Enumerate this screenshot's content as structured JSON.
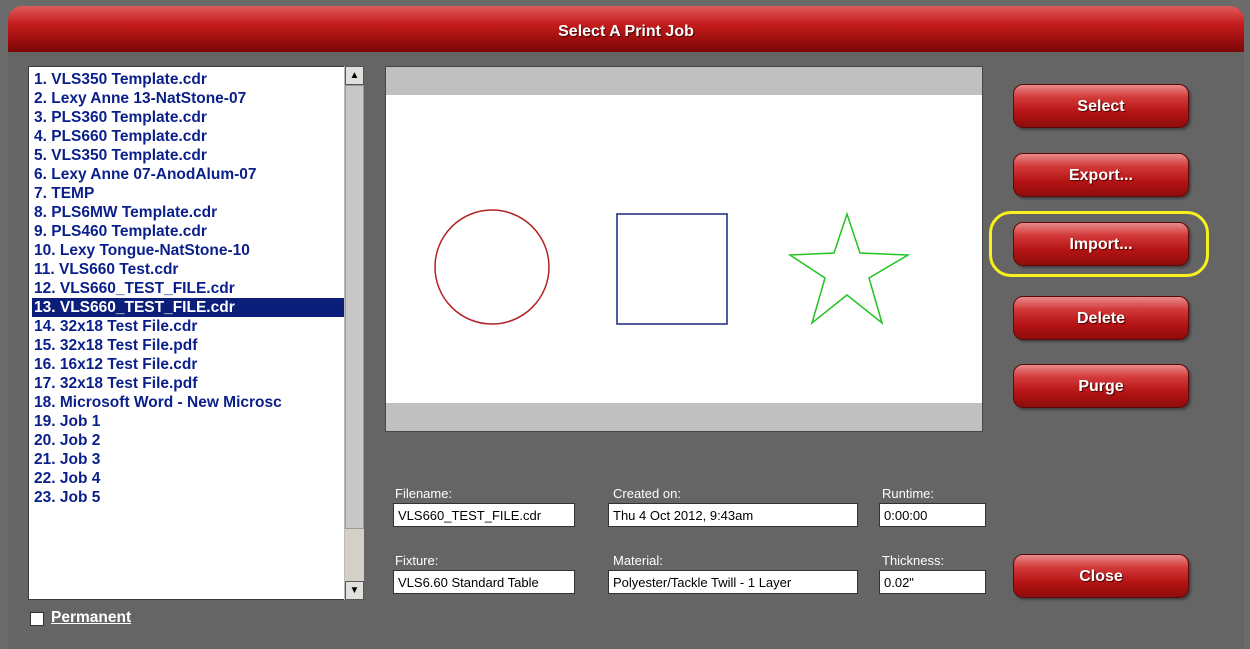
{
  "window": {
    "title": "Select A Print Job"
  },
  "job_list": {
    "items": [
      "1. VLS350 Template.cdr",
      "2. Lexy Anne 13-NatStone-07",
      "3. PLS360 Template.cdr",
      "4. PLS660 Template.cdr",
      "5. VLS350 Template.cdr",
      "6. Lexy Anne 07-AnodAlum-07",
      "7. TEMP",
      "8. PLS6MW Template.cdr",
      "9. PLS460 Template.cdr",
      "10. Lexy Tongue-NatStone-10",
      "11. VLS660 Test.cdr",
      "12. VLS660_TEST_FILE.cdr",
      "13. VLS660_TEST_FILE.cdr",
      "14. 32x18 Test File.cdr",
      "15. 32x18 Test File.pdf",
      "16. 16x12 Test File.cdr",
      "17. 32x18 Test File.pdf",
      "18. Microsoft Word - New Microsc",
      "19. Job 1",
      "20. Job 2",
      "21. Job 3",
      "22. Job 4",
      "23. Job 5"
    ],
    "selected_index": 12
  },
  "preview": {
    "shapes": [
      "circle",
      "square",
      "star"
    ],
    "colors": {
      "circle": "#b22222",
      "square": "#1a237e",
      "star": "#22c422"
    }
  },
  "fields": {
    "filename": {
      "label": "Filename:",
      "value": "VLS660_TEST_FILE.cdr"
    },
    "created": {
      "label": "Created on:",
      "value": "Thu 4 Oct 2012,  9:43am"
    },
    "runtime": {
      "label": "Runtime:",
      "value": "0:00:00"
    },
    "fixture": {
      "label": "Fixture:",
      "value": "VLS6.60 Standard Table"
    },
    "material": {
      "label": "Material:",
      "value": "Polyester/Tackle Twill - 1 Layer"
    },
    "thickness": {
      "label": "Thickness:",
      "value": "0.02\""
    }
  },
  "buttons": {
    "select": "Select",
    "export": "Export...",
    "import": "Import...",
    "delete": "Delete",
    "purge": "Purge",
    "close": "Close"
  },
  "permanent": {
    "label": "Permanent",
    "checked": false
  },
  "colors": {
    "title_red": "#c41c1c",
    "highlight": "#f7f21e",
    "selection": "#0b1f7a",
    "list_text": "#0a1f8a"
  }
}
